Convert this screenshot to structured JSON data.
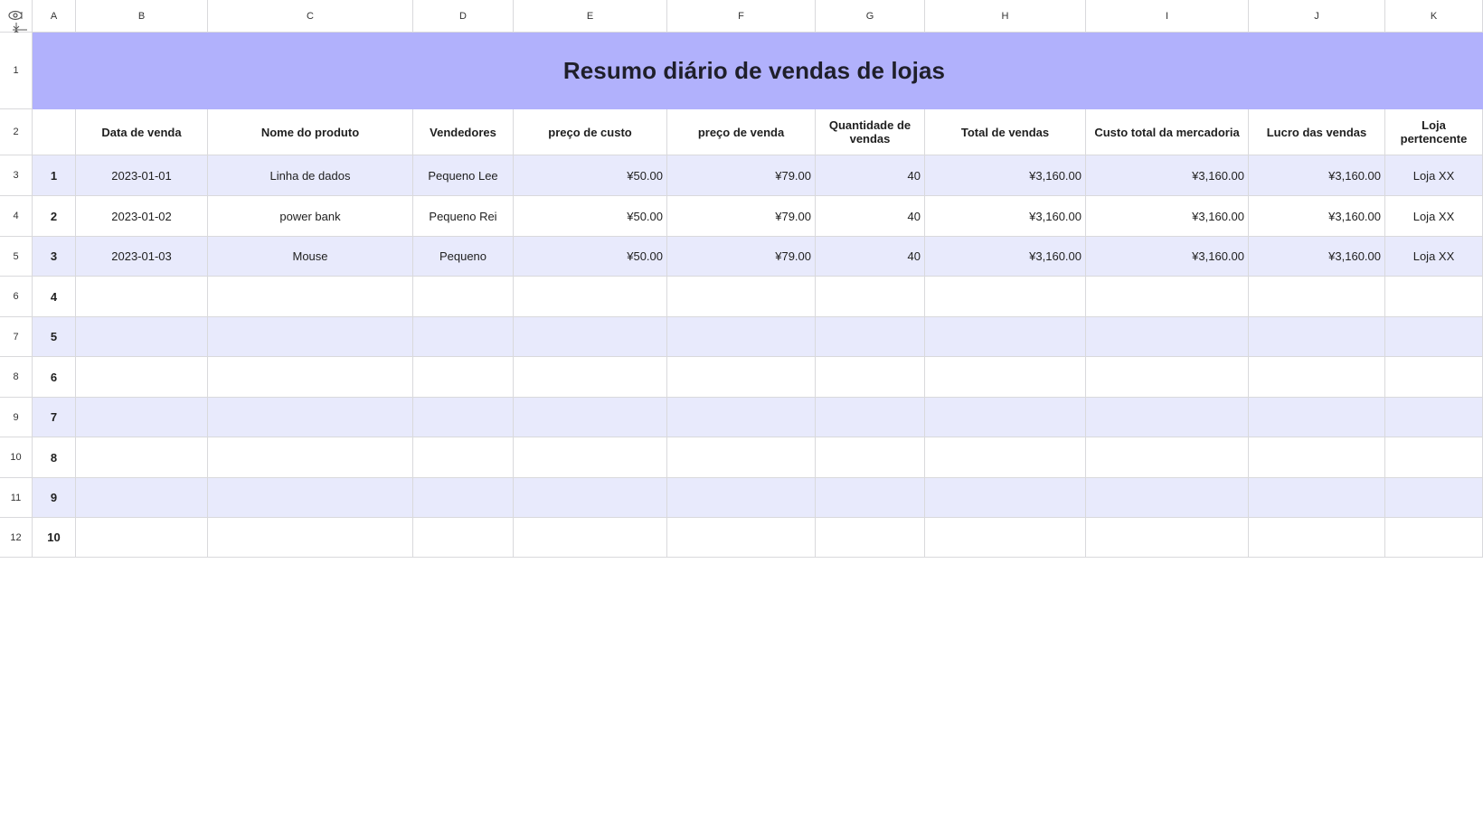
{
  "title": "Resumo diário de vendas de lojas",
  "columns": [
    "A",
    "B",
    "C",
    "D",
    "E",
    "F",
    "G",
    "H",
    "I",
    "J",
    "K"
  ],
  "row_numbers": [
    "1",
    "2",
    "3",
    "4",
    "5",
    "6",
    "7",
    "8",
    "9",
    "10",
    "11",
    "12"
  ],
  "headers": {
    "A": "",
    "B": "Data de venda",
    "C": "Nome do produto",
    "D": "Vendedores",
    "E": "preço de custo",
    "F": "preço de venda",
    "G": "Quantidade de vendas",
    "H": "Total de vendas",
    "I": "Custo total da mercadoria",
    "J": "Lucro das vendas",
    "K": "Loja pertencente"
  },
  "rows": [
    {
      "no": "1",
      "date": "2023-01-01",
      "product": "Linha de dados",
      "seller": "Pequeno Lee",
      "cost": "¥50.00",
      "price": "¥79.00",
      "qty": "40",
      "total": "¥3,160.00",
      "total_cost": "¥3,160.00",
      "profit": "¥3,160.00",
      "store": "Loja XX"
    },
    {
      "no": "2",
      "date": "2023-01-02",
      "product": "power bank",
      "seller": "Pequeno Rei",
      "cost": "¥50.00",
      "price": "¥79.00",
      "qty": "40",
      "total": "¥3,160.00",
      "total_cost": "¥3,160.00",
      "profit": "¥3,160.00",
      "store": "Loja XX"
    },
    {
      "no": "3",
      "date": "2023-01-03",
      "product": "Mouse",
      "seller": "Pequeno",
      "cost": "¥50.00",
      "price": "¥79.00",
      "qty": "40",
      "total": "¥3,160.00",
      "total_cost": "¥3,160.00",
      "profit": "¥3,160.00",
      "store": "Loja XX"
    },
    {
      "no": "4",
      "date": "",
      "product": "",
      "seller": "",
      "cost": "",
      "price": "",
      "qty": "",
      "total": "",
      "total_cost": "",
      "profit": "",
      "store": ""
    },
    {
      "no": "5",
      "date": "",
      "product": "",
      "seller": "",
      "cost": "",
      "price": "",
      "qty": "",
      "total": "",
      "total_cost": "",
      "profit": "",
      "store": ""
    },
    {
      "no": "6",
      "date": "",
      "product": "",
      "seller": "",
      "cost": "",
      "price": "",
      "qty": "",
      "total": "",
      "total_cost": "",
      "profit": "",
      "store": ""
    },
    {
      "no": "7",
      "date": "",
      "product": "",
      "seller": "",
      "cost": "",
      "price": "",
      "qty": "",
      "total": "",
      "total_cost": "",
      "profit": "",
      "store": ""
    },
    {
      "no": "8",
      "date": "",
      "product": "",
      "seller": "",
      "cost": "",
      "price": "",
      "qty": "",
      "total": "",
      "total_cost": "",
      "profit": "",
      "store": ""
    },
    {
      "no": "9",
      "date": "",
      "product": "",
      "seller": "",
      "cost": "",
      "price": "",
      "qty": "",
      "total": "",
      "total_cost": "",
      "profit": "",
      "store": ""
    },
    {
      "no": "10",
      "date": "",
      "product": "",
      "seller": "",
      "cost": "",
      "price": "",
      "qty": "",
      "total": "",
      "total_cost": "",
      "profit": "",
      "store": ""
    }
  ],
  "colors": {
    "title_band": "#b1b1fc",
    "row_band": "#e8eafc",
    "grid": "#d9d9dc"
  },
  "icons": {
    "corner_top": "eye-icon",
    "corner_bottom": "freeze-panes-icon"
  }
}
